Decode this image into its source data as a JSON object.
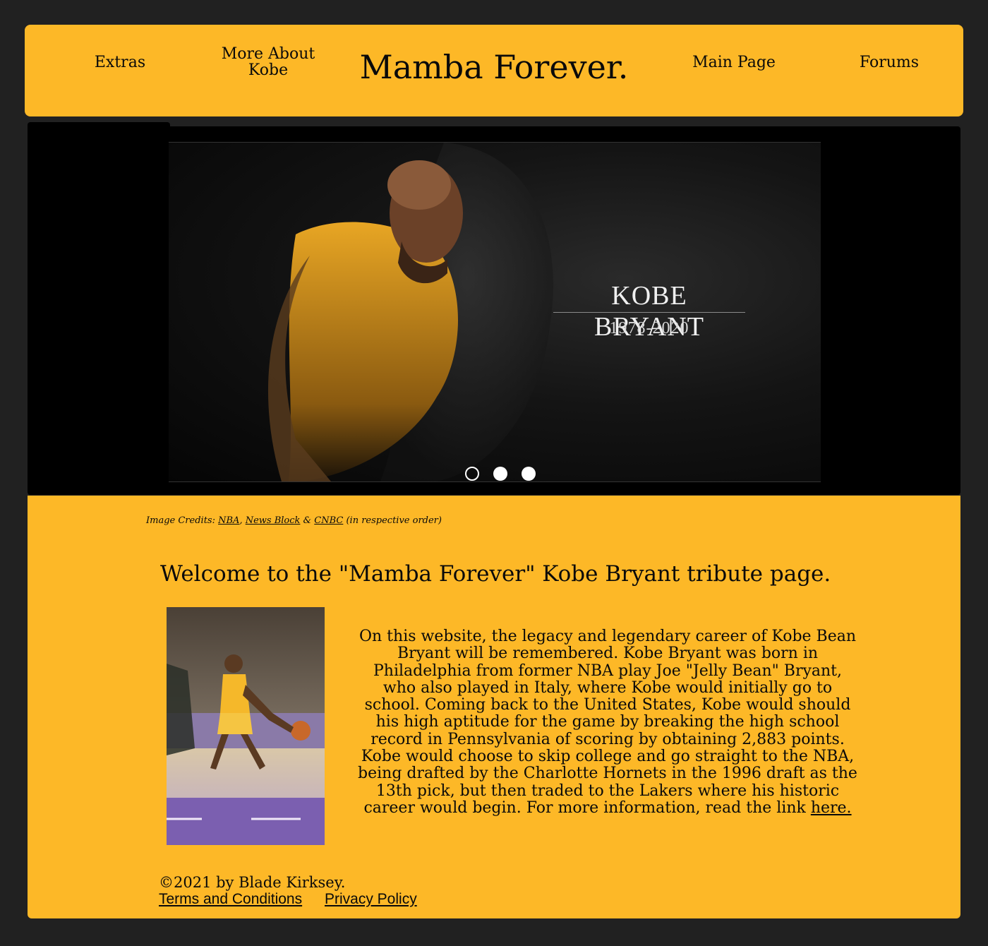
{
  "header": {
    "title": "Mamba Forever.",
    "nav": {
      "extras": "Extras",
      "more_about": "More About Kobe",
      "main_page": "Main Page",
      "forums": "Forums"
    }
  },
  "slider": {
    "name": "KOBE BRYANT",
    "years": "1978-2020",
    "active_slide": 1,
    "slide_count": 3
  },
  "content": {
    "credits": {
      "prefix": "Image Credits: ",
      "link1": "NBA",
      "sep1": ", ",
      "link2": "News Block",
      "sep2": " & ",
      "link3": "CNBC",
      "suffix": " (in respective order)"
    },
    "welcome": "Welcome to the \"Mamba Forever\" Kobe Bryant tribute page.",
    "bio_text": "On this website, the legacy and legendary career of Kobe Bean Bryant will be remembered. Kobe Bryant was born in Philadelphia from former NBA play Joe \"Jelly Bean\" Bryant, who also played in Italy, where Kobe would initially go to school. Coming back to the United States, Kobe would should his high aptitude for the game by breaking the high school record in Pennsylvania of scoring by obtaining 2,883 points. Kobe would choose to skip college and go straight to the NBA, being drafted by the Charlotte Hornets in the 1996 draft as the 13th pick, but then traded to the Lakers where his historic career would begin. For more information, read the link ",
    "bio_link": "here."
  },
  "footer": {
    "copyright": "©2021 by Blade Kirksey.",
    "terms": "Terms and Conditions",
    "privacy": "Privacy Policy"
  },
  "colors": {
    "background": "#212121",
    "accent": "#fdb827",
    "slider_bg": "#000000"
  }
}
